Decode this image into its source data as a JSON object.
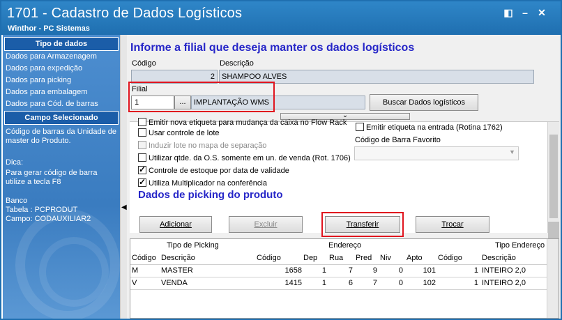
{
  "window": {
    "title": "1701 - Cadastro de Dados Logísticos",
    "subtitle": "Winthor - PC Sistemas",
    "restore_glyph": "◧",
    "minimize_glyph": "–",
    "close_glyph": "✕"
  },
  "sidebar": {
    "section1_title": "Tipo de dados",
    "links": [
      "Dados para Armazenagem",
      "Dados para expedição",
      "Dados para picking",
      "Dados para embalagem",
      "Dados para Cód. de barras"
    ],
    "section2_title": "Campo Selecionado",
    "description": "Código de barras da Unidade de master do Produto.",
    "tip_title": "Dica:",
    "tip_text": "Para gerar código de barra utilize a tecla F8",
    "db_title": "Banco",
    "db_table": "Tabela : PCPRODUT",
    "db_field": "Campo: CODAUXILIAR2"
  },
  "form": {
    "heading": "Informe a filial que deseja manter os dados logísticos",
    "codigo_label": "Código",
    "codigo_value": "2",
    "descricao_label": "Descrição",
    "descricao_value": "SHAMPOO ALVES",
    "filial_label": "Filial",
    "filial_value": "1",
    "filial_lookup": "...",
    "filial_name": "IMPLANTAÇÃO WMS",
    "buscar_button": "Buscar Dados logísticos",
    "collapse_glyph": "⌄"
  },
  "options": {
    "clipped_row": "Emitir nova etiqueta para mudança da caixa no Flow Rack",
    "items": [
      {
        "label": "Usar controle de lote",
        "checked": false,
        "disabled": false
      },
      {
        "label": "Induzir lote no mapa de separação",
        "checked": false,
        "disabled": true
      },
      {
        "label": "Utilizar qtde. da O.S. somente em un. de venda (Rot. 1706)",
        "checked": false,
        "disabled": false
      },
      {
        "label": "Controle de estoque por data de validade",
        "checked": true,
        "disabled": false
      },
      {
        "label": "Utiliza Multiplicador na conferência",
        "checked": true,
        "disabled": false
      }
    ],
    "emitir_etiqueta": "Emitir etiqueta na entrada (Rotina 1762)",
    "barra_favorito_label": "Código de Barra Favorito",
    "barra_favorito_value": ""
  },
  "picking": {
    "heading": "Dados de picking do produto",
    "adicionar": "Adicionar",
    "excluir": "Excluir",
    "transferir": "Transferir",
    "trocar": "Trocar",
    "group_headers": {
      "tipo_picking": "Tipo de Picking",
      "endereco": "Endereço",
      "tipo_endereco": "Tipo Endereço"
    },
    "columns": [
      "Código",
      "Descrição",
      "Código",
      "Dep",
      "Rua",
      "Pred",
      "Niv",
      "Apto",
      "Código",
      "Descrição"
    ],
    "rows": [
      [
        "M",
        "MASTER",
        "1658",
        "1",
        "7",
        "9",
        "0",
        "101",
        "1",
        "INTEIRO 2,0"
      ],
      [
        "V",
        "VENDA",
        "1415",
        "1",
        "6",
        "7",
        "0",
        "102",
        "1",
        "INTEIRO 2,0"
      ]
    ]
  },
  "colors": {
    "title_bar": "#1f6fb0",
    "sidebar": "#4d8ed0",
    "heading": "#2626c8",
    "highlight": "#e0141e"
  }
}
